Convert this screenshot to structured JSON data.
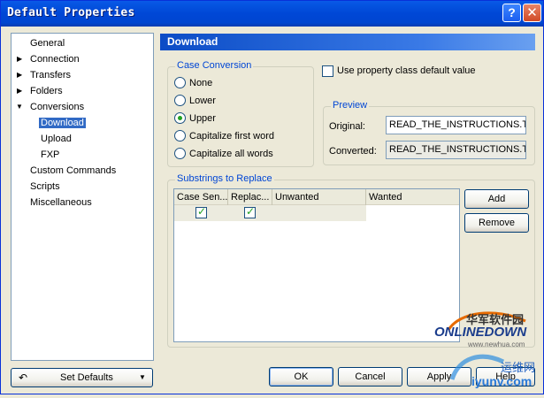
{
  "window": {
    "title": "Default Properties",
    "help_glyph": "?",
    "close_glyph": "✕"
  },
  "tree": {
    "items": [
      {
        "label": "General"
      },
      {
        "label": "Connection"
      },
      {
        "label": "Transfers"
      },
      {
        "label": "Folders"
      },
      {
        "label": "Conversions"
      },
      {
        "label": "Download"
      },
      {
        "label": "Upload"
      },
      {
        "label": "FXP"
      },
      {
        "label": "Custom Commands"
      },
      {
        "label": "Scripts"
      },
      {
        "label": "Miscellaneous"
      }
    ],
    "selected": "Download"
  },
  "header": {
    "title": "Download"
  },
  "case_conversion": {
    "title": "Case Conversion",
    "options": [
      "None",
      "Lower",
      "Upper",
      "Capitalize first word",
      "Capitalize all words"
    ],
    "selected": "Upper"
  },
  "use_default": {
    "label": "Use property class default value",
    "checked": false
  },
  "preview": {
    "title": "Preview",
    "original_label": "Original:",
    "original_value": "READ_THE_INSTRUCTIONS.T",
    "converted_label": "Converted:",
    "converted_value": "READ_THE_INSTRUCTIONS.T"
  },
  "substrings": {
    "title": "Substrings to Replace",
    "columns": [
      "Case Sen...",
      "Replac...",
      "Unwanted",
      "Wanted"
    ],
    "rows": [
      {
        "case_sensitive": true,
        "replace": true,
        "unwanted": "",
        "wanted": ""
      }
    ],
    "add_label": "Add",
    "remove_label": "Remove"
  },
  "footer": {
    "set_defaults_label": "Set Defaults",
    "ok_label": "OK",
    "cancel_label": "Cancel",
    "apply_label": "Apply",
    "help_label": "Help"
  },
  "watermark": {
    "line1": "华军软件园",
    "line2": "ONLINEDOWN",
    "line3": "www.newhua.com",
    "line4": "运维网",
    "line5": "iyunv.com"
  }
}
